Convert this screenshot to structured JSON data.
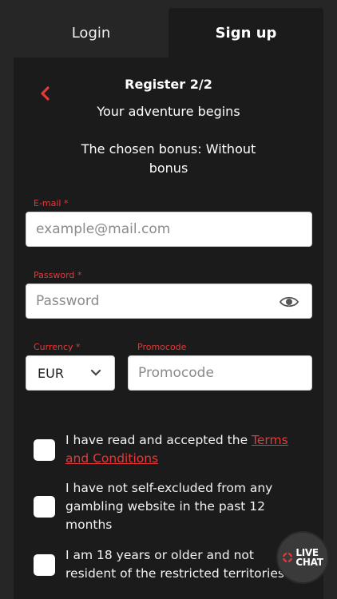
{
  "tabs": {
    "login": "Login",
    "signup": "Sign up"
  },
  "header": {
    "title": "Register 2/2",
    "subtitle": "Your adventure begins",
    "bonus": "The chosen bonus: Without bonus"
  },
  "form": {
    "email": {
      "label": "E-mail *",
      "placeholder": "example@mail.com",
      "value": ""
    },
    "password": {
      "label": "Password *",
      "placeholder": "Password",
      "value": ""
    },
    "currency": {
      "label": "Currency *",
      "value": "EUR"
    },
    "promocode": {
      "label": "Promocode",
      "placeholder": "Promocode",
      "value": ""
    }
  },
  "checks": {
    "terms_prefix": "I have read and accepted the ",
    "terms_link": "Terms and Conditions",
    "self_excluded": "I have not self-excluded from any gambling website in the past 12 months",
    "age": "I am 18 years or older and not resident of the restricted territories"
  },
  "live_chat": {
    "line1": "LIVE",
    "line2": "CHAT"
  },
  "colors": {
    "accent": "#e4393a",
    "panel": "#1b1b1b",
    "background": "#262626"
  }
}
